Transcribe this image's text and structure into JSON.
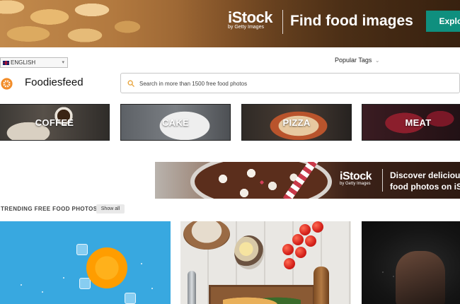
{
  "top_banner": {
    "brand": "iStock",
    "brand_sub": "by Getty Images",
    "headline": "Find food images",
    "cta_label": "Explore",
    "cta_color": "#0f8f7e"
  },
  "header": {
    "language": "ENGLISH",
    "popular_tags_label": "Popular Tags",
    "site_name": "Foodiesfeed",
    "search_placeholder": "Search in more than 1500 free food photos"
  },
  "categories": [
    {
      "label": "COFFEE"
    },
    {
      "label": "CAKE"
    },
    {
      "label": "PIZZA"
    },
    {
      "label": "MEAT"
    }
  ],
  "mid_banner": {
    "brand": "iStock",
    "brand_sub": "by Getty Images",
    "headline_line1": "Discover delicious",
    "headline_line2": "food photos on iStock"
  },
  "trending": {
    "title": "TRENDING FREE FOOD PHOTOS",
    "show_all_label": "Show all"
  },
  "icons": {
    "search": "search-icon",
    "logo": "foodiesfeed-logo",
    "flag": "uk-flag-icon",
    "dropdown": "chevron-down-icon"
  },
  "colors": {
    "accent": "#0f8f7e",
    "logo_orange": "#f28c28"
  }
}
